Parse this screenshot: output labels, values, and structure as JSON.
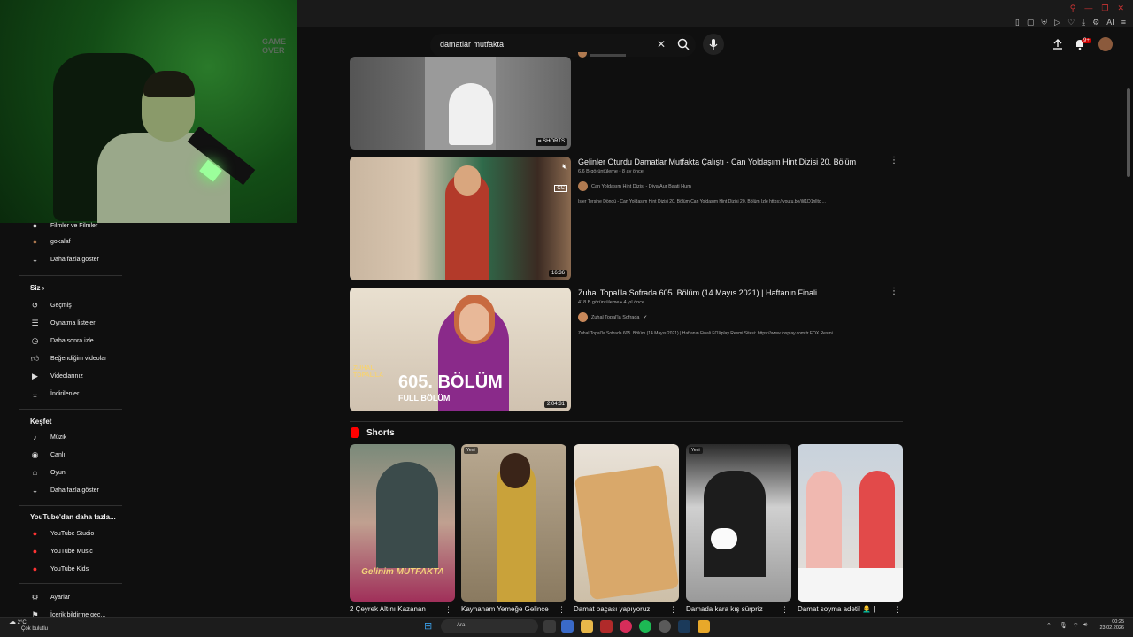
{
  "search": {
    "query": "damatlar mutfakta"
  },
  "header": {
    "notification_count": "9+"
  },
  "browser": {
    "ai_label": "AI"
  },
  "sidebar": {
    "top_items": [
      {
        "label": "Filmler ve Filmler"
      },
      {
        "label": "gokalaf"
      },
      {
        "label": "Daha fazla göster"
      }
    ],
    "you_section": {
      "title": "Siz",
      "items": [
        {
          "label": "Geçmiş"
        },
        {
          "label": "Oynatma listeleri"
        },
        {
          "label": "Daha sonra izle"
        },
        {
          "label": "Beğendiğim videolar"
        },
        {
          "label": "Videolarınız"
        },
        {
          "label": "İndirilenler"
        }
      ]
    },
    "explore_section": {
      "title": "Keşfet",
      "items": [
        {
          "label": "Müzik"
        },
        {
          "label": "Canlı"
        },
        {
          "label": "Oyun"
        },
        {
          "label": "Daha fazla göster"
        }
      ]
    },
    "more_section": {
      "title": "YouTube'dan daha fazla...",
      "items": [
        {
          "label": "YouTube Studio"
        },
        {
          "label": "YouTube Music"
        },
        {
          "label": "YouTube Kids"
        }
      ]
    },
    "bottom_items": [
      {
        "label": "Ayarlar"
      },
      {
        "label": "İçerik bildirme geç..."
      }
    ]
  },
  "webcam": {
    "sign_text": "GAME OVER"
  },
  "videos": [
    {
      "badge": "SHORTS"
    },
    {
      "title": "Gelinler Oturdu Damatlar Mutfakta Çalıştı - Can Yoldaşım Hint Dizisi 20. Bölüm",
      "meta": "6,6 B görüntüleme • 8 ay önce",
      "channel": "Can Yoldaşım Hint Dizisi - Diya Aur Baati Hum",
      "desc": "İşler Tersine Döndü - Can Yoldaşım Hint Dizisi 20. Bölüm Can Yoldaşım Hint Dizisi 20. Bölüm İzle https://youtu.be/ili|1D1nlltc ...",
      "duration": "16:36"
    },
    {
      "title": "Zuhal Topal'la Sofrada 605. Bölüm (14 Mayıs 2021) | Haftanın Finali",
      "meta": "418 B görüntüleme • 4 yıl önce",
      "channel": "Zuhal Topal'la Sofrada",
      "desc": "Zuhal Topal'la Sofrada 605. Bölüm (14 Mayıs 2021) | Haftanın Finali FOXplay Resmi Sitesi: https://www.foxplay.com.tr FOX Resmi ...",
      "duration": "2:04:31",
      "thumb_big": "605. BÖLÜM",
      "thumb_small": "FULL BÖLÜM",
      "thumb_logo": "ZUHAL TOPAL'LA"
    }
  ],
  "shorts": {
    "title": "Shorts",
    "items": [
      {
        "title": "2 Çeyrek Altını Kazanan",
        "badge": "",
        "overlay": "Gelinim MUTFAKTA"
      },
      {
        "title": "Kaynanam Yemeğe Gelince",
        "badge": "Yeni"
      },
      {
        "title": "Damat paçası yapıyoruz",
        "badge": ""
      },
      {
        "title": "Damada kara kış sürpriz",
        "badge": "Yeni"
      },
      {
        "title": "Damat soyma adeti! 👨‍🦲 |",
        "badge": ""
      }
    ]
  },
  "taskbar": {
    "weather_temp": "2°C",
    "weather_desc": "Çok bulutlu",
    "search_label": "Ara",
    "time": "00:25",
    "date": "23.02.2026"
  }
}
